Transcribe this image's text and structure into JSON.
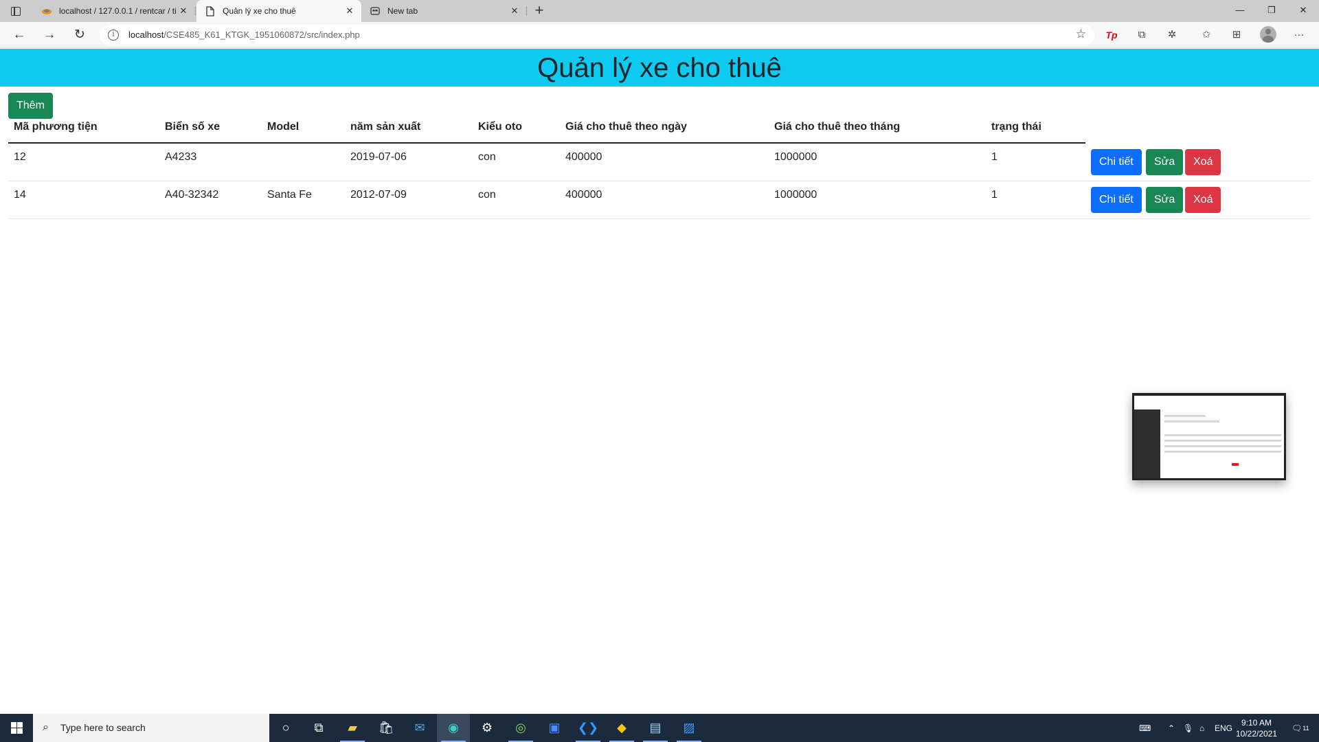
{
  "browser": {
    "tabs": [
      {
        "title": "localhost / 127.0.0.1 / rentcar / ti",
        "icon": "phpmyadmin-icon",
        "active": false
      },
      {
        "title": "Quản lý xe cho thuê",
        "icon": "page-icon",
        "active": true
      },
      {
        "title": "New tab",
        "icon": "newtab-icon",
        "active": false
      }
    ],
    "url_host": "localhost",
    "url_path": "/CSE485_K61_KTGK_1951060872/src/index.php"
  },
  "page": {
    "title": "Quản lý xe cho thuê",
    "add_button": "Thêm",
    "table": {
      "columns": [
        "Mã phương tiện",
        "Biển số xe",
        "Model",
        "năm sản xuất",
        "Kiểu oto",
        "Giá cho thuê theo ngày",
        "Giá cho thuê theo tháng",
        "trạng thái"
      ],
      "rows": [
        {
          "id": "12",
          "plate": "A4233",
          "model": "",
          "year": "2019-07-06",
          "type": "con",
          "price_day": "400000",
          "price_month": "1000000",
          "status": "1"
        },
        {
          "id": "14",
          "plate": "A40-32342",
          "model": "Santa Fe",
          "year": "2012-07-09",
          "type": "con",
          "price_day": "400000",
          "price_month": "1000000",
          "status": "1"
        }
      ],
      "actions": {
        "detail": "Chi tiết",
        "edit": "Sửa",
        "delete": "Xoá"
      }
    },
    "colors": {
      "header_bg": "#0dcaf0",
      "success": "#198754",
      "primary": "#0d6efd",
      "danger": "#dc3545"
    }
  },
  "taskbar": {
    "search_placeholder": "Type here to search",
    "language": "ENG",
    "time": "9:10 AM",
    "date": "10/22/2021",
    "notification_count": "11"
  }
}
